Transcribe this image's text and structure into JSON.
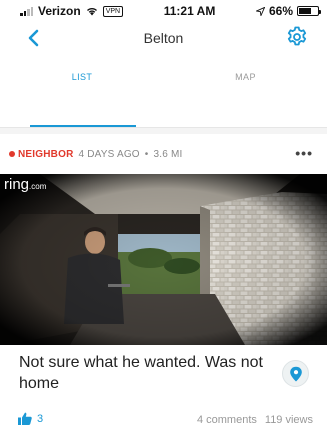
{
  "status_bar": {
    "carrier": "Verizon",
    "vpn": "VPN",
    "time": "11:21 AM",
    "battery": "66%",
    "battery_level": 0.66
  },
  "nav": {
    "title": "Belton"
  },
  "tabs": [
    {
      "label": "LIST",
      "active": true
    },
    {
      "label": "MAP",
      "active": false
    }
  ],
  "post": {
    "author": "NEIGHBOR",
    "time_ago": "4 DAYS AGO",
    "separator": "•",
    "distance": "3.6 MI",
    "more": "•••",
    "video": {
      "logo": "ring",
      "logo_suffix": ".com"
    },
    "caption": "Not sure what he wanted. Was not home",
    "likes": "3",
    "comments": "4 comments",
    "views": "119 views"
  },
  "colors": {
    "accent": "#1a98d5",
    "neighbor_red": "#e1392c"
  }
}
